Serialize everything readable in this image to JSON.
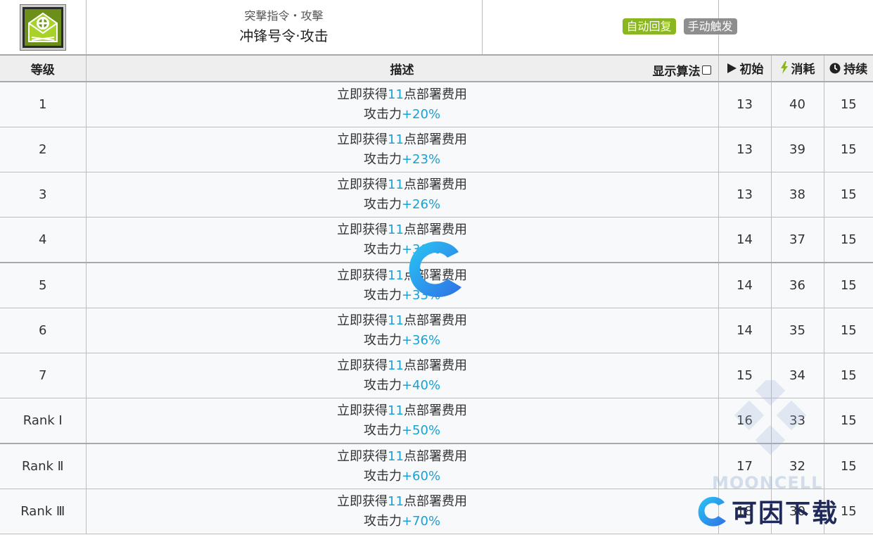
{
  "skill": {
    "subtitle": "突撃指令・攻擊",
    "name": "冲锋号令·攻击",
    "badges": [
      "自动回复",
      "手动触发"
    ]
  },
  "table": {
    "headers": {
      "level": "等级",
      "desc": "描述",
      "algo_toggle": "显示算法",
      "initial": "初始",
      "cost": "消耗",
      "duration": "持续"
    },
    "rows": [
      {
        "level": "1",
        "line1_pre": "立即获得",
        "line1_num": "11",
        "line1_post": "点部署费用",
        "line2_pre": "攻击力",
        "line2_val": "+20%",
        "initial": "13",
        "cost": "40",
        "duration": "15"
      },
      {
        "level": "2",
        "line1_pre": "立即获得",
        "line1_num": "11",
        "line1_post": "点部署费用",
        "line2_pre": "攻击力",
        "line2_val": "+23%",
        "initial": "13",
        "cost": "39",
        "duration": "15"
      },
      {
        "level": "3",
        "line1_pre": "立即获得",
        "line1_num": "11",
        "line1_post": "点部署费用",
        "line2_pre": "攻击力",
        "line2_val": "+26%",
        "initial": "13",
        "cost": "38",
        "duration": "15"
      },
      {
        "level": "4",
        "line1_pre": "立即获得",
        "line1_num": "11",
        "line1_post": "点部署费用",
        "line2_pre": "攻击力",
        "line2_val": "+30%",
        "initial": "14",
        "cost": "37",
        "duration": "15"
      },
      {
        "level": "5",
        "line1_pre": "立即获得",
        "line1_num": "11",
        "line1_post": "点部署费用",
        "line2_pre": "攻击力",
        "line2_val": "+33%",
        "initial": "14",
        "cost": "36",
        "duration": "15"
      },
      {
        "level": "6",
        "line1_pre": "立即获得",
        "line1_num": "11",
        "line1_post": "点部署费用",
        "line2_pre": "攻击力",
        "line2_val": "+36%",
        "initial": "14",
        "cost": "35",
        "duration": "15"
      },
      {
        "level": "7",
        "line1_pre": "立即获得",
        "line1_num": "11",
        "line1_post": "点部署费用",
        "line2_pre": "攻击力",
        "line2_val": "+40%",
        "initial": "15",
        "cost": "34",
        "duration": "15"
      },
      {
        "level": "Rank Ⅰ",
        "line1_pre": "立即获得",
        "line1_num": "11",
        "line1_post": "点部署费用",
        "line2_pre": "攻击力",
        "line2_val": "+50%",
        "initial": "16",
        "cost": "33",
        "duration": "15"
      },
      {
        "level": "Rank Ⅱ",
        "line1_pre": "立即获得",
        "line1_num": "11",
        "line1_post": "点部署费用",
        "line2_pre": "攻击力",
        "line2_val": "+60%",
        "initial": "17",
        "cost": "32",
        "duration": "15"
      },
      {
        "level": "Rank Ⅲ",
        "line1_pre": "立即获得",
        "line1_num": "11",
        "line1_post": "点部署费用",
        "line2_pre": "攻击力",
        "line2_val": "+70%",
        "initial": "18",
        "cost": "30",
        "duration": "15"
      }
    ]
  },
  "watermark": {
    "faint_text": "MOONCELL",
    "brand": "可因下载"
  },
  "colors": {
    "highlight": "#1a9fd6",
    "badge_auto": "#8ab61f",
    "badge_manual": "#8e8e8e",
    "cost_icon": "#8ab61f"
  },
  "icons": [
    "skill-icon",
    "play-icon",
    "lightning-icon",
    "clock-icon",
    "checkbox-icon",
    "loading-logo-icon",
    "brand-logo-icon"
  ]
}
